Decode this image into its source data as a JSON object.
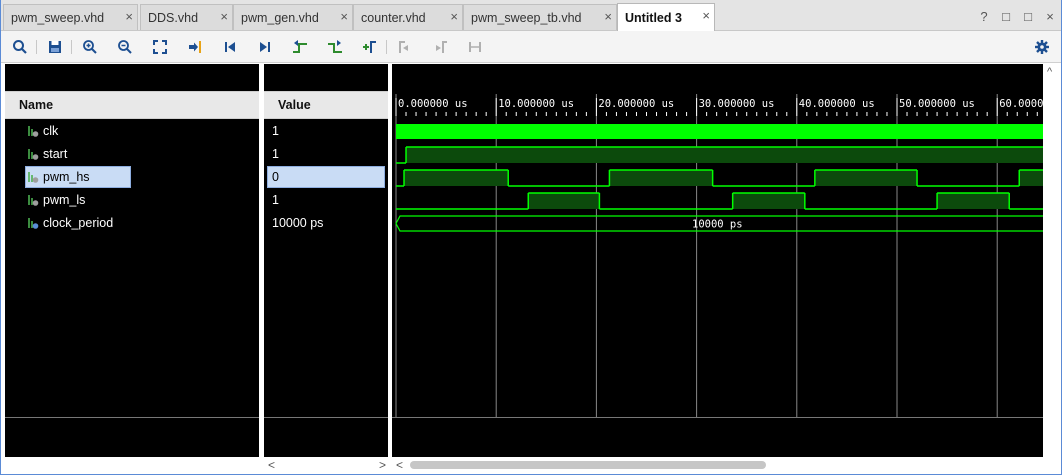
{
  "tabs": [
    {
      "label": "pwm_sweep.vhd",
      "active": false
    },
    {
      "label": "DDS.vhd",
      "active": false
    },
    {
      "label": "pwm_gen.vhd",
      "active": false
    },
    {
      "label": "counter.vhd",
      "active": false
    },
    {
      "label": "pwm_sweep_tb.vhd",
      "active": false
    },
    {
      "label": "Untitled 3",
      "active": true
    }
  ],
  "tab_close_glyph": "×",
  "window_controls": [
    "?",
    "□",
    "□",
    "×"
  ],
  "toolbar_icons": [
    "search-icon",
    "save-icon",
    "zoom-in-icon",
    "zoom-out-icon",
    "zoom-fit-icon",
    "go-to-cursor-icon",
    "go-to-start-icon",
    "go-to-end-icon",
    "previous-transition-icon",
    "next-transition-icon",
    "add-marker-icon",
    "previous-marker-icon",
    "next-marker-icon",
    "swap-cursors-icon",
    "settings-gear-icon"
  ],
  "name_column": {
    "header": "Name"
  },
  "value_column": {
    "header": "Value"
  },
  "signals": [
    {
      "name": "clk",
      "value": "1",
      "icon": "logic-signal-icon",
      "selected": false
    },
    {
      "name": "start",
      "value": "1",
      "icon": "logic-signal-icon",
      "selected": false
    },
    {
      "name": "pwm_hs",
      "value": "0",
      "icon": "logic-signal-icon",
      "selected": true
    },
    {
      "name": "pwm_ls",
      "value": "1",
      "icon": "logic-signal-icon",
      "selected": false
    },
    {
      "name": "clock_period",
      "value": "10000 ps",
      "icon": "time-signal-icon",
      "selected": false
    }
  ],
  "timeline": {
    "unit": "us",
    "tick_labels": [
      "0.000000 us",
      "10.000000 us",
      "20.000000 us",
      "30.000000 us",
      "40.000000 us",
      "50.000000 us",
      "60.000000 us"
    ],
    "visible_range_us": [
      0,
      65
    ],
    "major_step_us": 10
  },
  "waveforms": {
    "clk": {
      "type": "clock"
    },
    "start": {
      "type": "logic",
      "transitions_us": [
        [
          0,
          0
        ],
        [
          1.0,
          1
        ]
      ]
    },
    "pwm_hs": {
      "type": "logic",
      "transitions_us": [
        [
          0,
          0
        ],
        [
          0.8,
          1
        ],
        [
          11.2,
          0
        ],
        [
          21.3,
          1
        ],
        [
          31.6,
          0
        ],
        [
          41.8,
          1
        ],
        [
          52.0,
          0
        ],
        [
          62.2,
          1
        ]
      ]
    },
    "pwm_ls": {
      "type": "logic",
      "transitions_us": [
        [
          0,
          0
        ],
        [
          13.2,
          1
        ],
        [
          20.3,
          0
        ],
        [
          33.6,
          1
        ],
        [
          40.8,
          0
        ],
        [
          54.0,
          1
        ],
        [
          61.2,
          0
        ]
      ]
    },
    "clock_period": {
      "type": "bus",
      "label": "10000 ps"
    }
  },
  "colors": {
    "wave": "#00ff00",
    "wave_fill": "#0c4a0c",
    "grid": "#888888",
    "selection": "#c9dcf5",
    "accent": "#1a5fb4"
  },
  "scroll_arrows": {
    "left": "<",
    "right": ">",
    "up": "^"
  }
}
